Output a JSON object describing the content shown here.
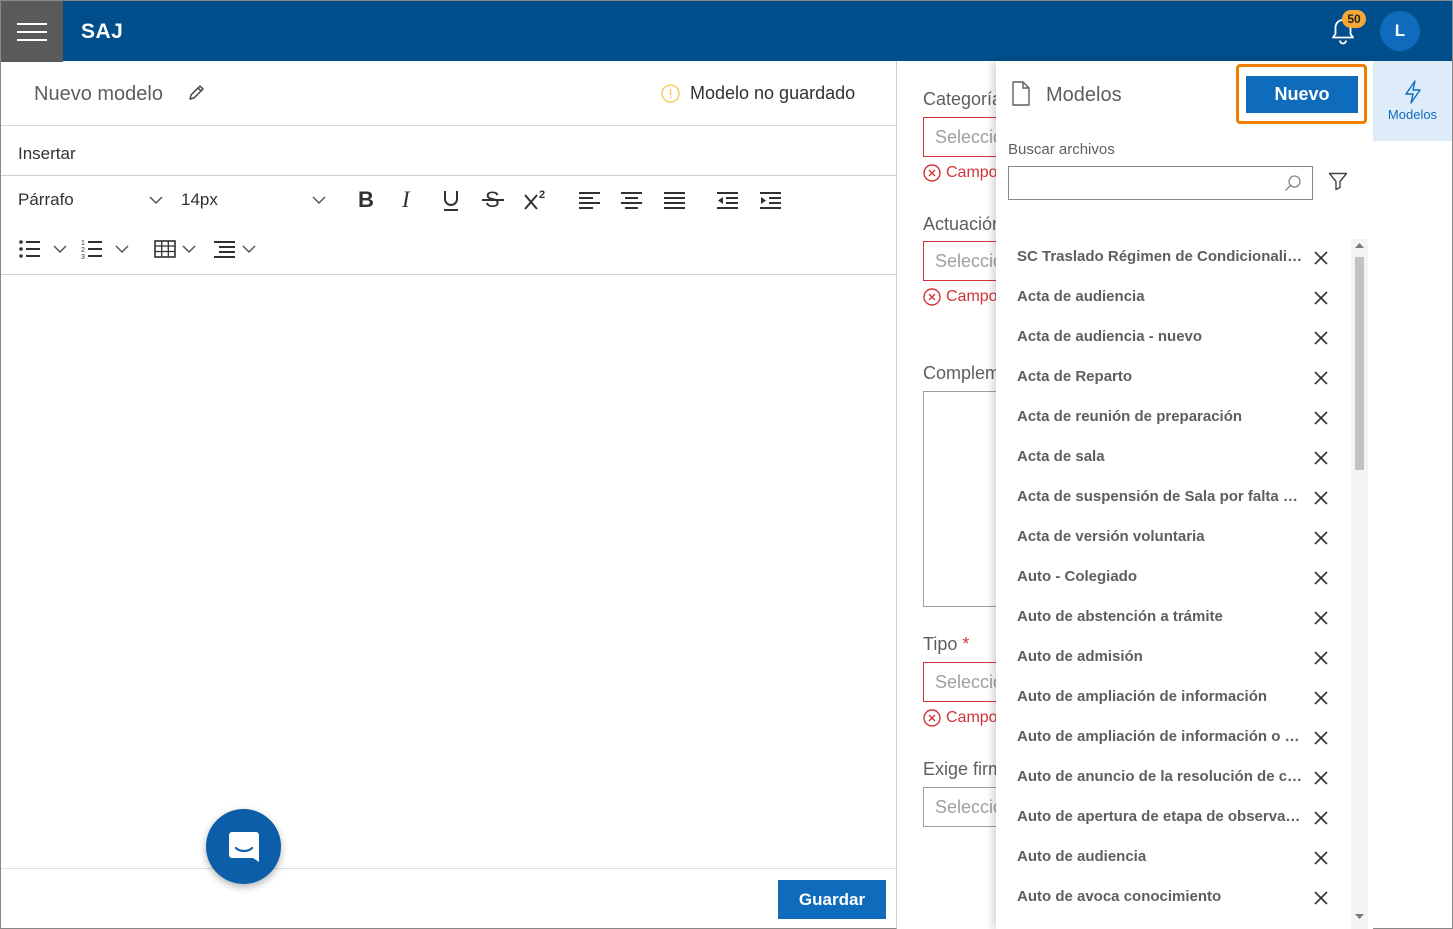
{
  "header": {
    "brand": "SAJ",
    "notification_count": "50",
    "user_initial": "L"
  },
  "editor": {
    "title": "Nuevo modelo",
    "status": "Modelo no guardado",
    "menu_insert": "Insertar",
    "paragraph_style": "Párrafo",
    "font_size": "14px",
    "save_label": "Guardar"
  },
  "form": {
    "categoria_label": "Categoría",
    "actuacion_label": "Actuación",
    "complemento_label": "Complemento",
    "tipo_label": "Tipo",
    "exige_firma_label": "Exige firma",
    "select_placeholder": "Seleccionar",
    "error_text": "Campo obligatorio"
  },
  "panel": {
    "title": "Modelos",
    "new_label": "Nuevo",
    "search_label": "Buscar archivos",
    "items": [
      "SC Traslado Régimen de Condicionalidad",
      "Acta de audiencia",
      "Acta de audiencia - nuevo",
      "Acta de Reparto",
      "Acta de reunión de preparación",
      "Acta de sala",
      "Acta de suspensión de Sala por falta de quórum",
      "Acta de versión voluntaria",
      "Auto - Colegiado",
      "Auto de abstención a trámite",
      "Auto de admisión",
      "Auto de ampliación de información",
      "Auto de ampliación de información o documentos",
      "Auto de anuncio de la resolución de conflicto",
      "Auto de apertura de etapa de observaciones",
      "Auto de audiencia",
      "Auto de avoca conocimiento"
    ]
  },
  "rail": {
    "modelos_label": "Modelos"
  },
  "colors": {
    "topbar": "#004e8c",
    "accent": "#0f6cbd",
    "highlight": "#f07f00",
    "error": "#d13438",
    "badge": "#f7a836"
  }
}
